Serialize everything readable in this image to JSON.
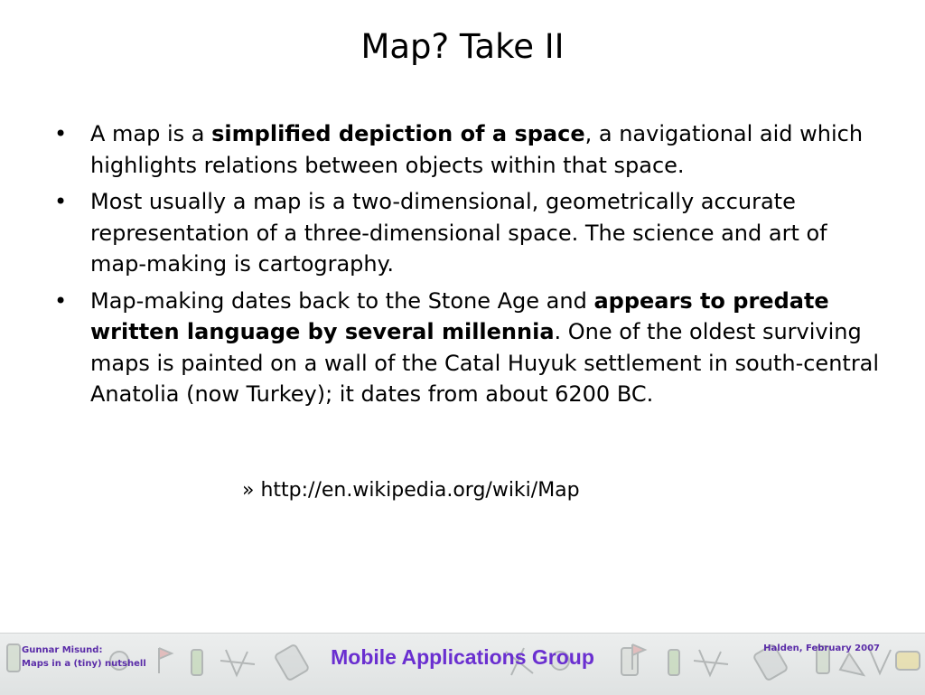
{
  "slide": {
    "title": "Map? Take II",
    "bullets": [
      {
        "marker": "•",
        "parts": [
          "A map is a ",
          "simplified depiction of a space",
          ", a navigational aid which highlights relations between objects within that space."
        ]
      },
      {
        "marker": "•",
        "text": "Most usually a map is a two-dimensional, geometrically accurate representation of a three-dimensional space. The science and art of map-making is cartography."
      },
      {
        "marker": "•",
        "parts": [
          "Map-making dates back to the Stone Age and ",
          "appears to predate written language by several millennia",
          ". One of the oldest surviving maps is painted on a wall of the Catal Huyuk settlement in south-central Anatolia (now Turkey); it dates from about 6200 BC."
        ]
      }
    ],
    "source": "» http://en.wikipedia.org/wiki/Map"
  },
  "footer": {
    "author": "Gunnar Misund:",
    "subtitle": "Maps in a (tiny) nutshell",
    "group": "Mobile Applications Group",
    "date": "Halden, February 2007",
    "accent_color": "#6a2fd0",
    "decorations": [
      "phone-icon",
      "gps-device-icon",
      "compass-icon",
      "pda-icon",
      "flag-icon"
    ]
  }
}
